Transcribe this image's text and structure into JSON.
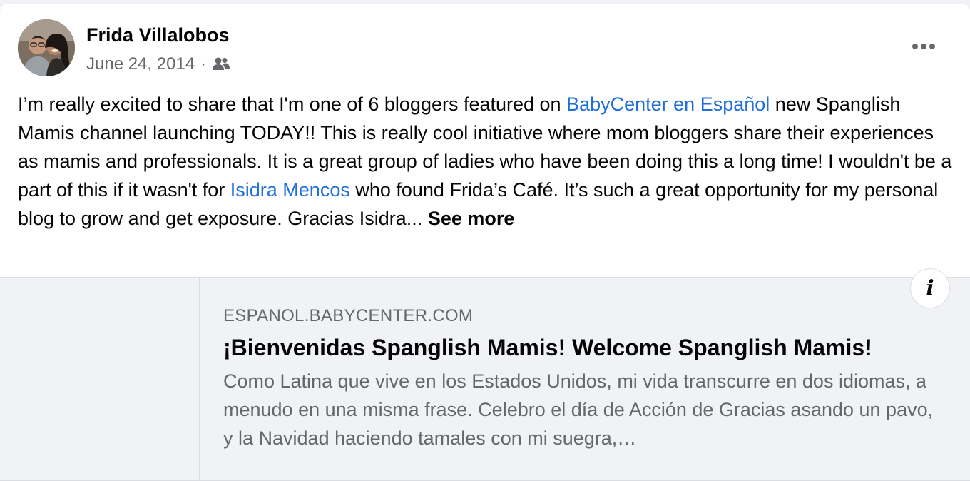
{
  "post": {
    "author": "Frida Villalobos",
    "date": "June 24, 2014",
    "separator": "·",
    "audience_icon": "friends-icon",
    "more_icon": "more-options-icon",
    "text_segments": {
      "s1": "I’m really excited to share that I'm one of 6 bloggers featured on ",
      "mention1": "BabyCenter en Español",
      "s2": " new Spanglish Mamis channel launching TODAY!! This is really cool initiative where mom bloggers share their experiences as mamis and professionals. It is a great group of ladies who have been doing this a long time! I wouldn't be a part of this if it wasn't for ",
      "mention2": "Isidra Mencos",
      "s3": " who found Frida’s Café. It’s such a great opportunity for my personal blog to grow and get exposure. Gracias Isidra... ",
      "see_more": "See more"
    }
  },
  "link_preview": {
    "domain": "ESPANOL.BABYCENTER.COM",
    "title": "¡Bienvenidas Spanglish Mamis! Welcome Spanglish Mamis!",
    "description": "Como Latina que vive en los Estados Unidos, mi vida transcurre en dos idiomas, a menudo en una misma frase. Celebro el día de Acción de Gracias asando un pavo, y la Navidad haciendo tamales con mi suegra,…",
    "info_label": "i"
  },
  "colors": {
    "link": "#216fdb",
    "secondary_text": "#65676b",
    "primary_text": "#050505",
    "preview_bg": "#f0f2f5"
  }
}
